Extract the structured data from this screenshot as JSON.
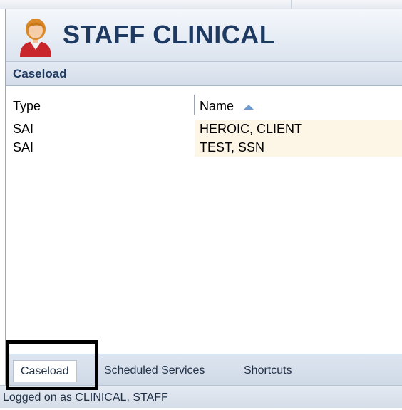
{
  "app": {
    "title": "STAFF CLINICAL",
    "avatar_icon": "user-avatar-icon"
  },
  "section": {
    "title": "Caseload"
  },
  "grid": {
    "columns": [
      {
        "label": "Type"
      },
      {
        "label": "Name",
        "sort": "ascending"
      }
    ],
    "rows": [
      {
        "type": "SAI",
        "name": "HEROIC, CLIENT"
      },
      {
        "type": "SAI",
        "name": "TEST, SSN"
      }
    ]
  },
  "tabs": [
    {
      "label": "Caseload",
      "active": true
    },
    {
      "label": "Scheduled Services",
      "active": false
    },
    {
      "label": "Shortcuts",
      "active": false
    }
  ],
  "status": {
    "text": "Logged on as CLINICAL, STAFF"
  },
  "colors": {
    "title": "#1f3a61",
    "row_highlight": "#fdf6e6",
    "annotation_box": "#000000"
  }
}
